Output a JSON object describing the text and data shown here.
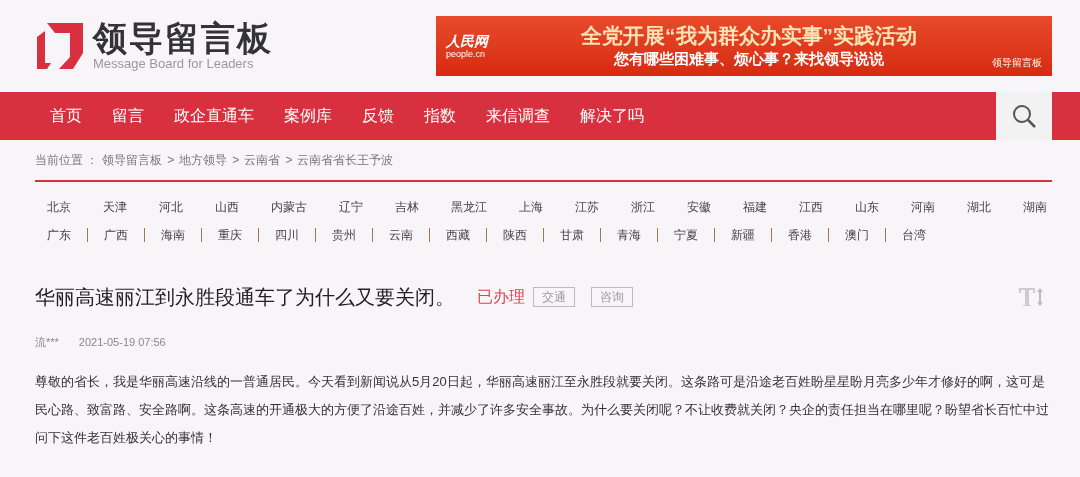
{
  "header": {
    "logo_title": "领导留言板",
    "logo_subtitle": "Message Board for Leaders"
  },
  "banner": {
    "source_logo": "人民网",
    "source_domain": "people.cn",
    "headline": "全党开展“我为群众办实事”实践活动",
    "subline": "您有哪些困难事、烦心事？来找领导说说",
    "brand": "领导留言板"
  },
  "nav": {
    "items": [
      {
        "label": "首页"
      },
      {
        "label": "留言"
      },
      {
        "label": "政企直通车"
      },
      {
        "label": "案例库"
      },
      {
        "label": "反馈"
      },
      {
        "label": "指数"
      },
      {
        "label": "来信调查"
      },
      {
        "label": "解决了吗"
      }
    ]
  },
  "breadcrumb": {
    "label": "当前位置 ：",
    "items": [
      "领导留言板",
      "地方领导",
      "云南省",
      "云南省省长王予波"
    ],
    "separator": ">"
  },
  "regions": [
    [
      "北京",
      "天津",
      "河北",
      "山西",
      "内蒙古",
      "辽宁",
      "吉林",
      "黑龙江",
      "上海",
      "江苏",
      "浙江",
      "安徽",
      "福建",
      "江西",
      "山东",
      "河南",
      "湖北",
      "湖南"
    ],
    [
      "广东",
      "广西",
      "海南",
      "重庆",
      "四川",
      "贵州",
      "云南",
      "西藏",
      "陕西",
      "甘肃",
      "青海",
      "宁夏",
      "新疆",
      "香港",
      "澳门",
      "台湾"
    ]
  ],
  "message": {
    "title": "华丽高速丽江到永胜段通车了为什么又要关闭。",
    "status": "已办理",
    "tags": [
      "交通",
      "咨询"
    ],
    "author": "流***",
    "date": "2021-05-19 07:56",
    "body": "尊敬的省长，我是华丽高速沿线的一普通居民。今天看到新闻说从5月20日起，华丽高速丽江至永胜段就要关闭。这条路可是沿途老百姓盼星星盼月亮多少年才修好的啊，这可是民心路、致富路、安全路啊。这条高速的开通极大的方便了沿途百姓，并减少了许多安全事故。为什么要关闭呢？不让收费就关闭？央企的责任担当在哪里呢？盼望省长百忙中过问下这件老百姓极关心的事情！"
  }
}
